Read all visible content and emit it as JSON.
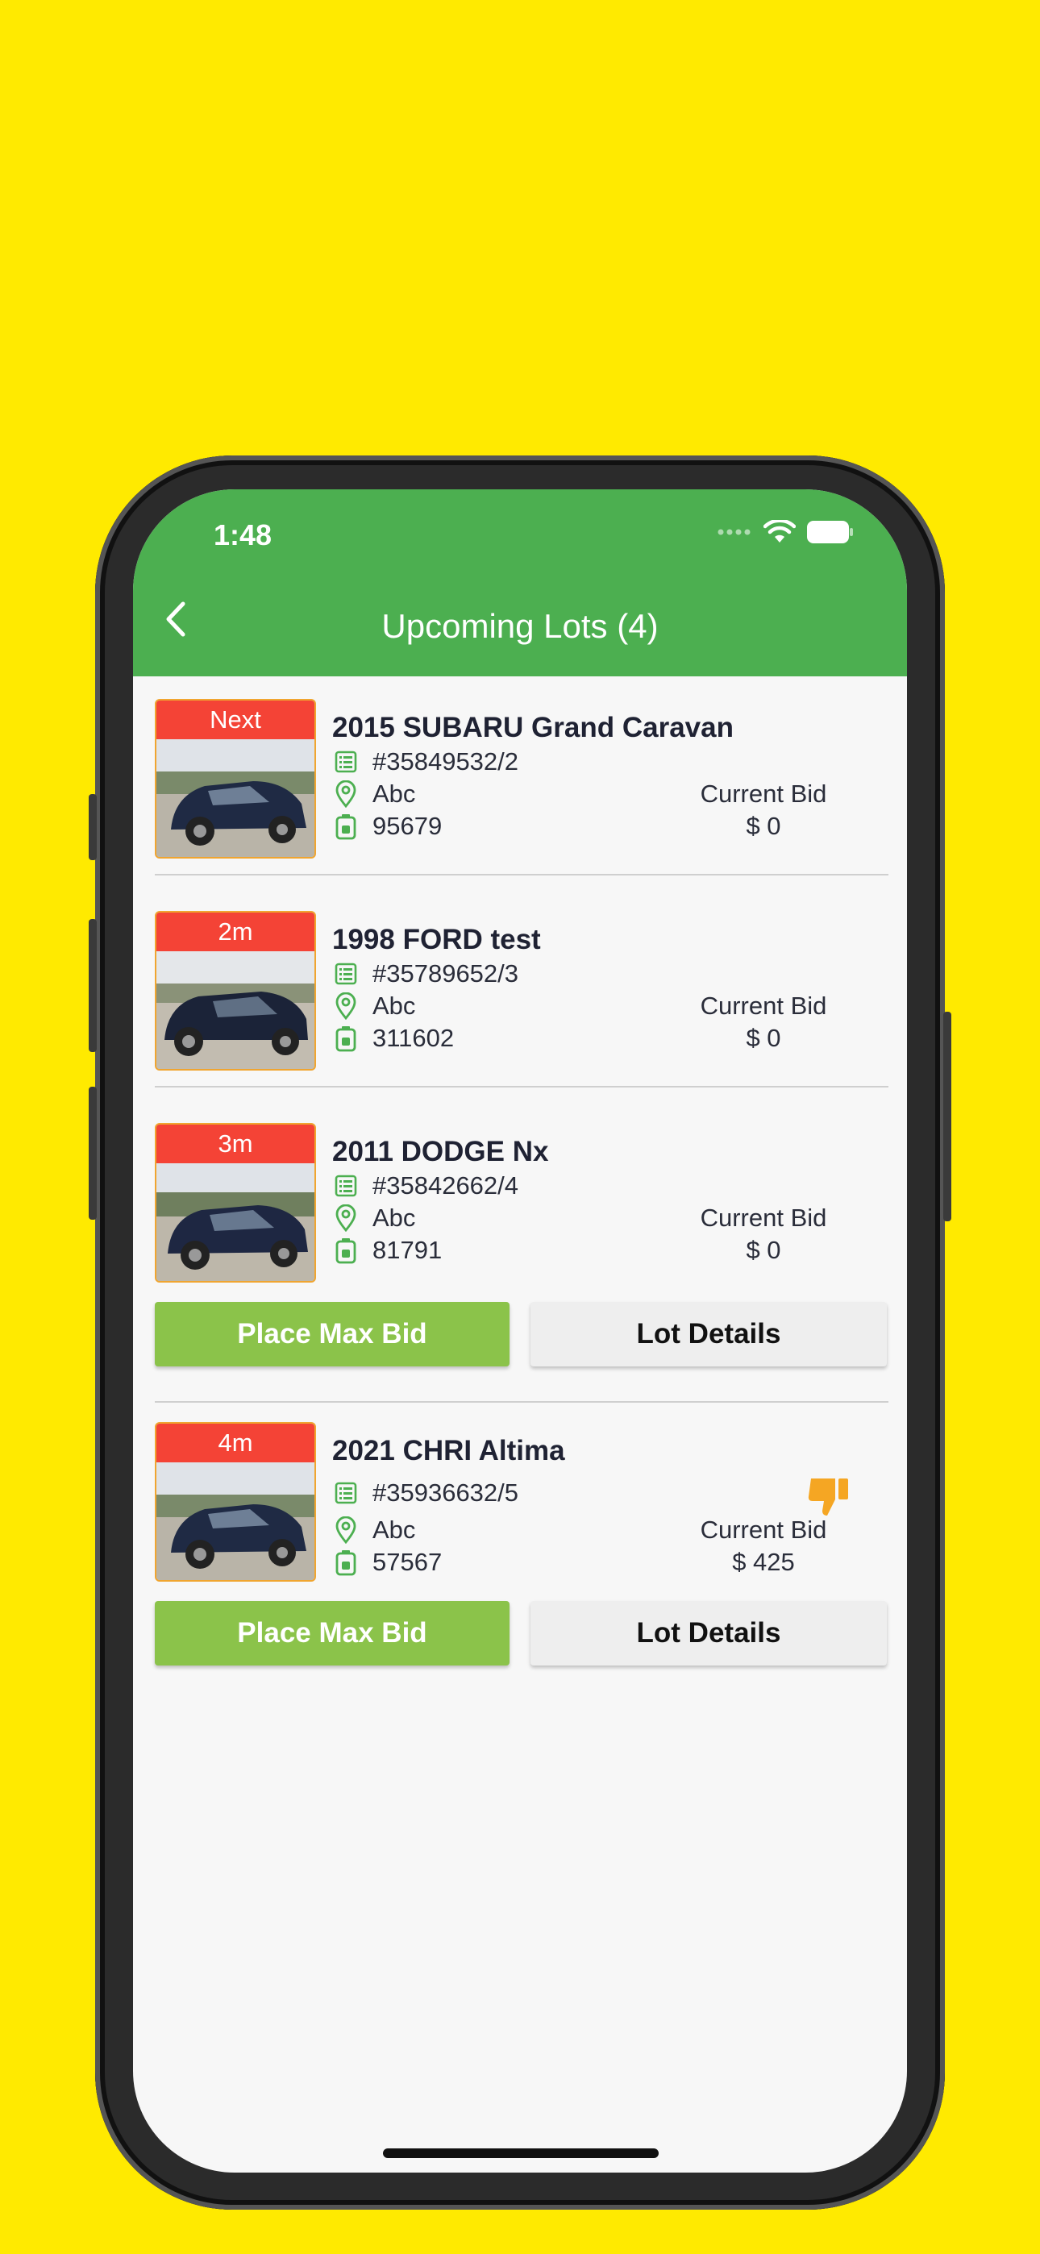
{
  "status_bar": {
    "time": "1:48"
  },
  "header": {
    "title": "Upcoming Lots (4)",
    "back_icon": "chevron-left-icon"
  },
  "colors": {
    "background": "#FFEA00",
    "app_bar": "#4CAF50",
    "timer_badge": "#F44336",
    "place_bid_button": "#8BC34A",
    "lot_details_button": "#EEEEEE",
    "icon_green": "#4CAF50",
    "thumb_down": "#F5A623"
  },
  "lots": [
    {
      "timer": "Next",
      "title": "2015 SUBARU Grand Caravan",
      "lot_number": "#35849532/2",
      "location": "Abc",
      "odometer": "95679",
      "bid_label": "Current Bid",
      "bid_value": "$ 0",
      "actions_visible": false
    },
    {
      "timer": "2m",
      "title": "1998 FORD test",
      "lot_number": "#35789652/3",
      "location": "Abc",
      "odometer": "311602",
      "bid_label": "Current Bid",
      "bid_value": "$ 0",
      "actions_visible": false
    },
    {
      "timer": "3m",
      "title": "2011 DODGE Nx",
      "lot_number": "#35842662/4",
      "location": "Abc",
      "odometer": "81791",
      "bid_label": "Current Bid",
      "bid_value": "$ 0",
      "actions_visible": true,
      "place_bid_label": "Place Max Bid",
      "details_label": "Lot Details"
    },
    {
      "timer": "4m",
      "title": "2021 CHRI Altima",
      "lot_number": "#35936632/5",
      "location": "Abc",
      "odometer": "57567",
      "bid_label": "Current Bid",
      "bid_value": "$ 425",
      "status_icon": "thumbs-down-icon",
      "actions_visible": true,
      "place_bid_label": "Place Max Bid",
      "details_label": "Lot Details"
    }
  ]
}
